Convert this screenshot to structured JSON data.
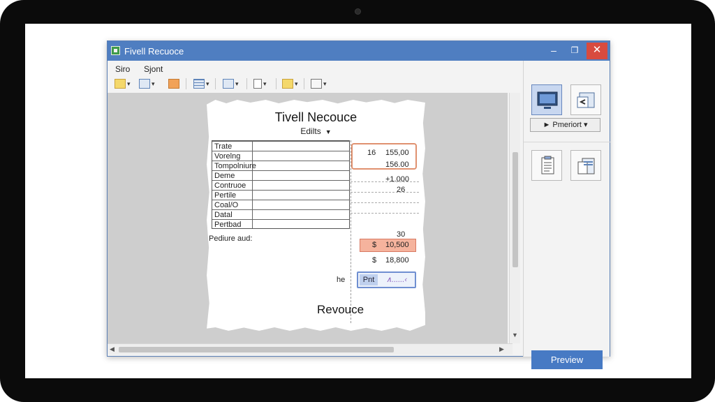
{
  "window": {
    "title": "Fivell Recuoce",
    "controls": {
      "minimize": "–",
      "maximize": "❐",
      "close": "✕"
    }
  },
  "menu": [
    {
      "label": "Siro"
    },
    {
      "label": "Sjont"
    }
  ],
  "document": {
    "title": "Tivell Necouce",
    "subtitle": "Edilts",
    "rows": [
      "Trate",
      "Vorelng",
      "Tompolniure",
      "Deme",
      "Contruoe",
      "Pertile",
      "Coal/O",
      "Datal",
      "Pertbad"
    ],
    "values": [
      {
        "left": "16",
        "right": "155,00"
      },
      {
        "right": "156.00"
      },
      {
        "right": "+1.000"
      },
      {
        "right": "26"
      },
      {
        "right": "30"
      }
    ],
    "subtotal_label": "Pediure aud:",
    "currency": "$",
    "highlight_amount": "10,500",
    "total_amount": "18,800",
    "signature_prefix": "he",
    "print_label": "Pnt",
    "signature_text": "∧......‹",
    "footer_title": "Revouce"
  },
  "sidepanel": {
    "dropdown_label": "► Pmeriort ▾",
    "preview_label": "Preview"
  },
  "colors": {
    "titlebar": "#4f7ec1",
    "close_button": "#d84b3f",
    "accent_button": "#477ac4",
    "orange_highlight": "#f5b39d"
  }
}
